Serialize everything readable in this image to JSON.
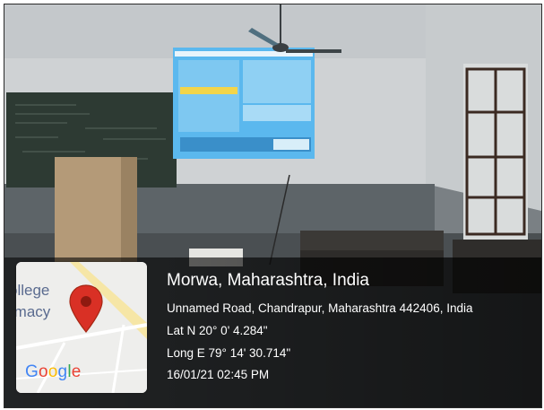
{
  "map": {
    "place_fragment_1": "ollege",
    "place_fragment_2": "rmacy",
    "logo": "Google",
    "pin_icon": "map-pin-icon"
  },
  "geotag": {
    "location": "Morwa, Maharashtra, India",
    "address": "Unnamed Road, Chandrapur, Maharashtra 442406, India",
    "latitude": "Lat N 20° 0' 4.284\"",
    "longitude": "Long E 79° 14' 30.714\"",
    "datetime": "16/01/21 02:45 PM"
  },
  "colors": {
    "pin": "#d93025",
    "overlay": "#000000",
    "text": "#ffffff"
  }
}
